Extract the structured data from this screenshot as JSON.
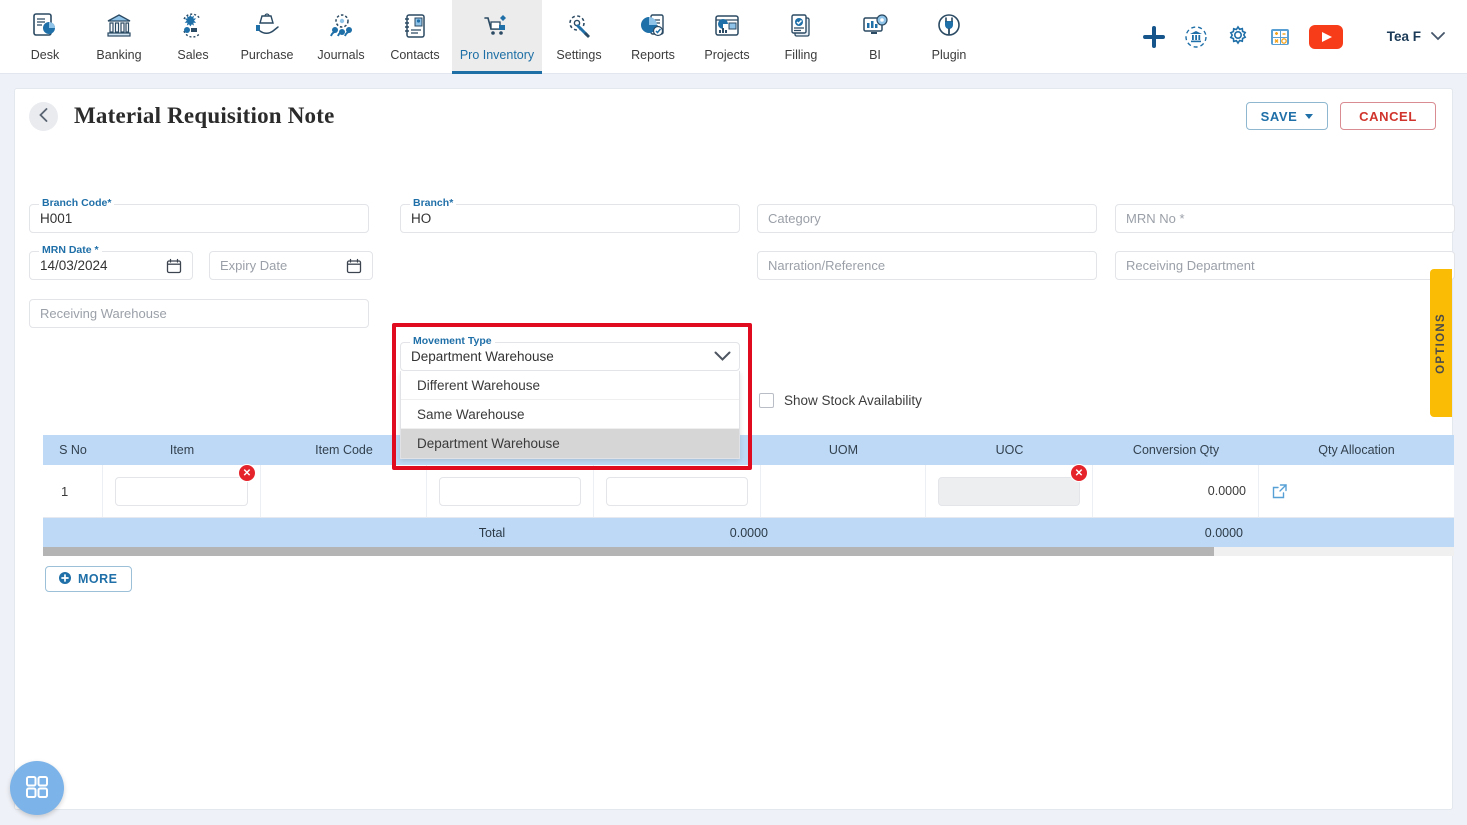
{
  "nav": {
    "items": [
      {
        "label": "Desk",
        "icon": "dashboard-icon",
        "active": false
      },
      {
        "label": "Banking",
        "icon": "bank-icon",
        "active": false
      },
      {
        "label": "Sales",
        "icon": "sales-icon",
        "active": false
      },
      {
        "label": "Purchase",
        "icon": "purchase-icon",
        "active": false
      },
      {
        "label": "Journals",
        "icon": "journals-icon",
        "active": false
      },
      {
        "label": "Contacts",
        "icon": "contacts-icon",
        "active": false
      },
      {
        "label": "Pro Inventory",
        "icon": "inventory-icon",
        "active": true
      },
      {
        "label": "Settings",
        "icon": "settings-icon",
        "active": false
      },
      {
        "label": "Reports",
        "icon": "reports-icon",
        "active": false
      },
      {
        "label": "Projects",
        "icon": "projects-icon",
        "active": false
      },
      {
        "label": "Filling",
        "icon": "filling-icon",
        "active": false
      },
      {
        "label": "BI",
        "icon": "bi-icon",
        "active": false
      },
      {
        "label": "Plugin",
        "icon": "plugin-icon",
        "active": false
      }
    ],
    "right_icons": [
      "plus-icon",
      "bank-refresh-icon",
      "gear-icon",
      "calculator-icon",
      "youtube-icon"
    ],
    "user": "Tea F"
  },
  "header": {
    "title": "Material Requisition Note",
    "back_icon": "chevron-left-icon",
    "save_label": "SAVE",
    "cancel_label": "CANCEL"
  },
  "form": {
    "branch_code": {
      "legend": "Branch Code",
      "required": "*",
      "value": "H001"
    },
    "branch": {
      "legend": "Branch",
      "required": "*",
      "value": "HO"
    },
    "category": {
      "placeholder": "Category",
      "value": ""
    },
    "mrn_no": {
      "placeholder": "MRN No *",
      "value": ""
    },
    "mrn_date": {
      "legend": "MRN Date",
      "required": "*",
      "value": "14/03/2024",
      "icon": "calendar-icon"
    },
    "expiry_date": {
      "placeholder": "Expiry Date",
      "value": "",
      "icon": "calendar-icon"
    },
    "narration": {
      "placeholder": "Narration/Reference",
      "value": ""
    },
    "receiving_department": {
      "placeholder": "Receiving Department",
      "value": ""
    },
    "receiving_warehouse": {
      "placeholder": "Receiving Warehouse",
      "value": ""
    },
    "movement_type": {
      "legend": "Movement Type",
      "value": "Department Warehouse",
      "chevron_icon": "chevron-down-icon",
      "expanded": true,
      "options": [
        {
          "label": "Different Warehouse",
          "selected": false
        },
        {
          "label": "Same Warehouse",
          "selected": false
        },
        {
          "label": "Department Warehouse",
          "selected": true
        }
      ]
    },
    "show_stock_availability": {
      "label": "Show Stock Availability",
      "checked": false
    }
  },
  "table": {
    "columns": [
      "S No",
      "Item",
      "Item Code",
      "",
      "",
      "UOM",
      "UOC",
      "Conversion Qty",
      "Qty Allocation"
    ],
    "rows": [
      {
        "s_no": "1",
        "item": "",
        "item_code": "",
        "col4": "",
        "col5": "",
        "uom": "",
        "uoc": "",
        "conversion_qty": "0.0000",
        "qty_allocation_icon": "external-link-icon",
        "delete_icon": "delete-badge-icon"
      }
    ],
    "total": {
      "label": "Total",
      "value_1": "0.0000",
      "value_2": "0.0000"
    }
  },
  "footer": {
    "more_label": "MORE",
    "more_icon": "plus-circle-icon"
  },
  "options_tab": {
    "label": "OPTIONS"
  },
  "fab": {
    "icon": "grid-apps-icon"
  },
  "colors": {
    "accent_blue": "#1f6fa8",
    "table_header": "#bdd9f5",
    "danger_red": "#e5232b",
    "highlight_red": "#e00b1e",
    "options_yellow": "#fbbc05",
    "fab_blue": "#7cb3e8"
  }
}
